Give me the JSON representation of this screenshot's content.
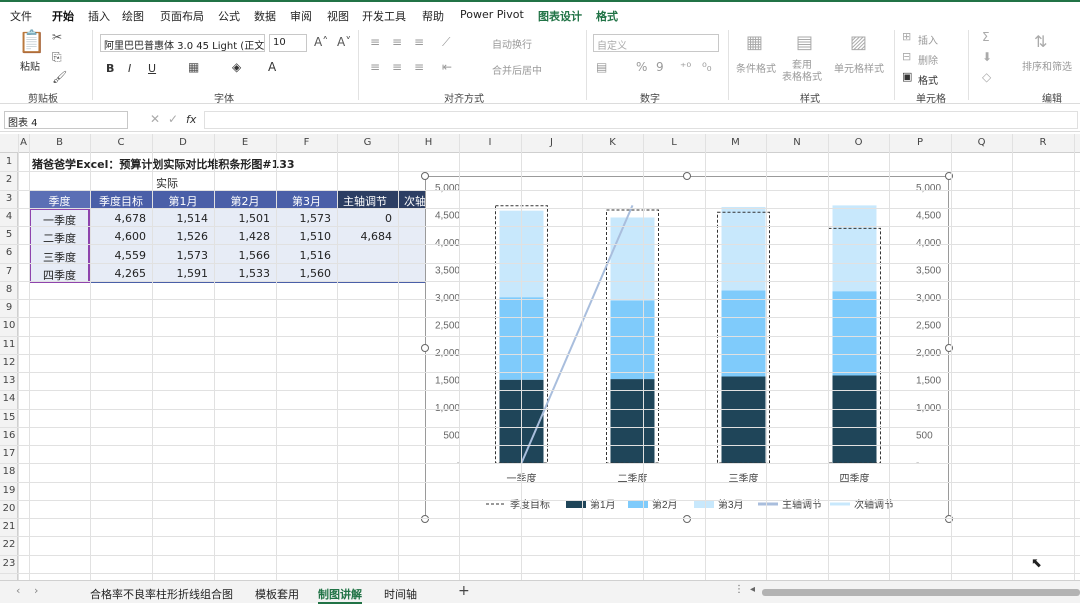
{
  "menu": {
    "items": [
      "文件",
      "开始",
      "插入",
      "绘图",
      "页面布局",
      "公式",
      "数据",
      "审阅",
      "视图",
      "开发工具",
      "帮助",
      "Power Pivot",
      "图表设计",
      "格式"
    ],
    "active_index": 1
  },
  "ribbon": {
    "clipboard": {
      "paste": "粘贴",
      "label": "剪贴板"
    },
    "font": {
      "name": "阿里巴巴普惠体 3.0 45 Light (正文)",
      "size": "10",
      "label": "字体",
      "bold": "B",
      "italic": "I",
      "underline": "U"
    },
    "alignment": {
      "wrap": "自动换行",
      "merge": "合并后居中",
      "label": "对齐方式"
    },
    "number": {
      "format": "自定义",
      "label": "数字"
    },
    "styles": {
      "cond_format": "条件格式",
      "table_format": "套用\n表格格式",
      "cell_style": "单元格样式",
      "label": "样式"
    },
    "cells": {
      "insert": "插入",
      "delete": "删除",
      "format": "格式",
      "label": "单元格"
    },
    "editing": {
      "sort_filter": "排序和筛选",
      "label": "编辑"
    }
  },
  "formula_bar": {
    "name_box": "图表 4",
    "fx": "fx",
    "content": ""
  },
  "grid": {
    "columns": [
      "A",
      "B",
      "C",
      "D",
      "E",
      "F",
      "G",
      "H",
      "I",
      "J",
      "K",
      "L",
      "M",
      "N",
      "O",
      "P",
      "Q",
      "R"
    ],
    "rows": [
      "1",
      "2",
      "3",
      "4",
      "5",
      "6",
      "7",
      "8",
      "9",
      "10",
      "11",
      "12",
      "13",
      "14",
      "15",
      "16",
      "17",
      "18",
      "19",
      "20",
      "21",
      "22",
      "23"
    ],
    "title": "猪爸爸学Excel：预算计划实际对比堆积条形图#133",
    "actual_label": "实际",
    "headers": [
      "季度",
      "季度目标",
      "第1月",
      "第2月",
      "第3月",
      "主轴调节",
      "次轴调节"
    ],
    "table": [
      [
        "一季度",
        "4,678",
        "1,514",
        "1,501",
        "1,573",
        "0",
        ""
      ],
      [
        "二季度",
        "4,600",
        "1,526",
        "1,428",
        "1,510",
        "4,684",
        ""
      ],
      [
        "三季度",
        "4,559",
        "1,573",
        "1,566",
        "1,516",
        "",
        ""
      ],
      [
        "四季度",
        "4,265",
        "1,591",
        "1,533",
        "1,560",
        "",
        ""
      ]
    ]
  },
  "chart_data": {
    "type": "bar",
    "categories": [
      "一季度",
      "二季度",
      "三季度",
      "四季度"
    ],
    "series": [
      {
        "name": "季度目标",
        "values": [
          4678,
          4600,
          4559,
          4265
        ],
        "style": "dashed-outline"
      },
      {
        "name": "第1月",
        "values": [
          1514,
          1526,
          1573,
          1591
        ],
        "color": "#1f4559"
      },
      {
        "name": "第2月",
        "values": [
          1501,
          1428,
          1566,
          1533
        ],
        "color": "#7fcbfb"
      },
      {
        "name": "第3月",
        "values": [
          1573,
          1510,
          1516,
          1560
        ],
        "color": "#c8e8fc"
      },
      {
        "name": "主轴调节",
        "values": [
          0,
          4684
        ],
        "type": "line",
        "color": "#a9bedd"
      },
      {
        "name": "次轴调节",
        "values": [],
        "type": "line",
        "color": "#c8e8fc"
      }
    ],
    "ylim": [
      0,
      5000
    ],
    "y_ticks": [
      "-",
      "500",
      "1,000",
      "1,500",
      "2,000",
      "2,500",
      "3,000",
      "3,500",
      "4,000",
      "4,500",
      "5,000"
    ],
    "secondary_y_ticks": [
      "-",
      "500",
      "1,000",
      "1,500",
      "2,000",
      "2,500",
      "3,000",
      "3,500",
      "4,000",
      "4,500",
      "5,000"
    ],
    "legend_position": "bottom",
    "grid": false
  },
  "sheet_tabs": {
    "items": [
      "合格率不良率柱形折线组合图",
      "模板套用",
      "制图讲解",
      "时间轴"
    ],
    "active_index": 2,
    "add": "+"
  },
  "colors": {
    "accent": "#217346",
    "header_fill": "#4a5fa8",
    "table_fill": "#e7ecf6",
    "first_col": "#5b6fb5",
    "highlight_border": "#8e44ad"
  }
}
